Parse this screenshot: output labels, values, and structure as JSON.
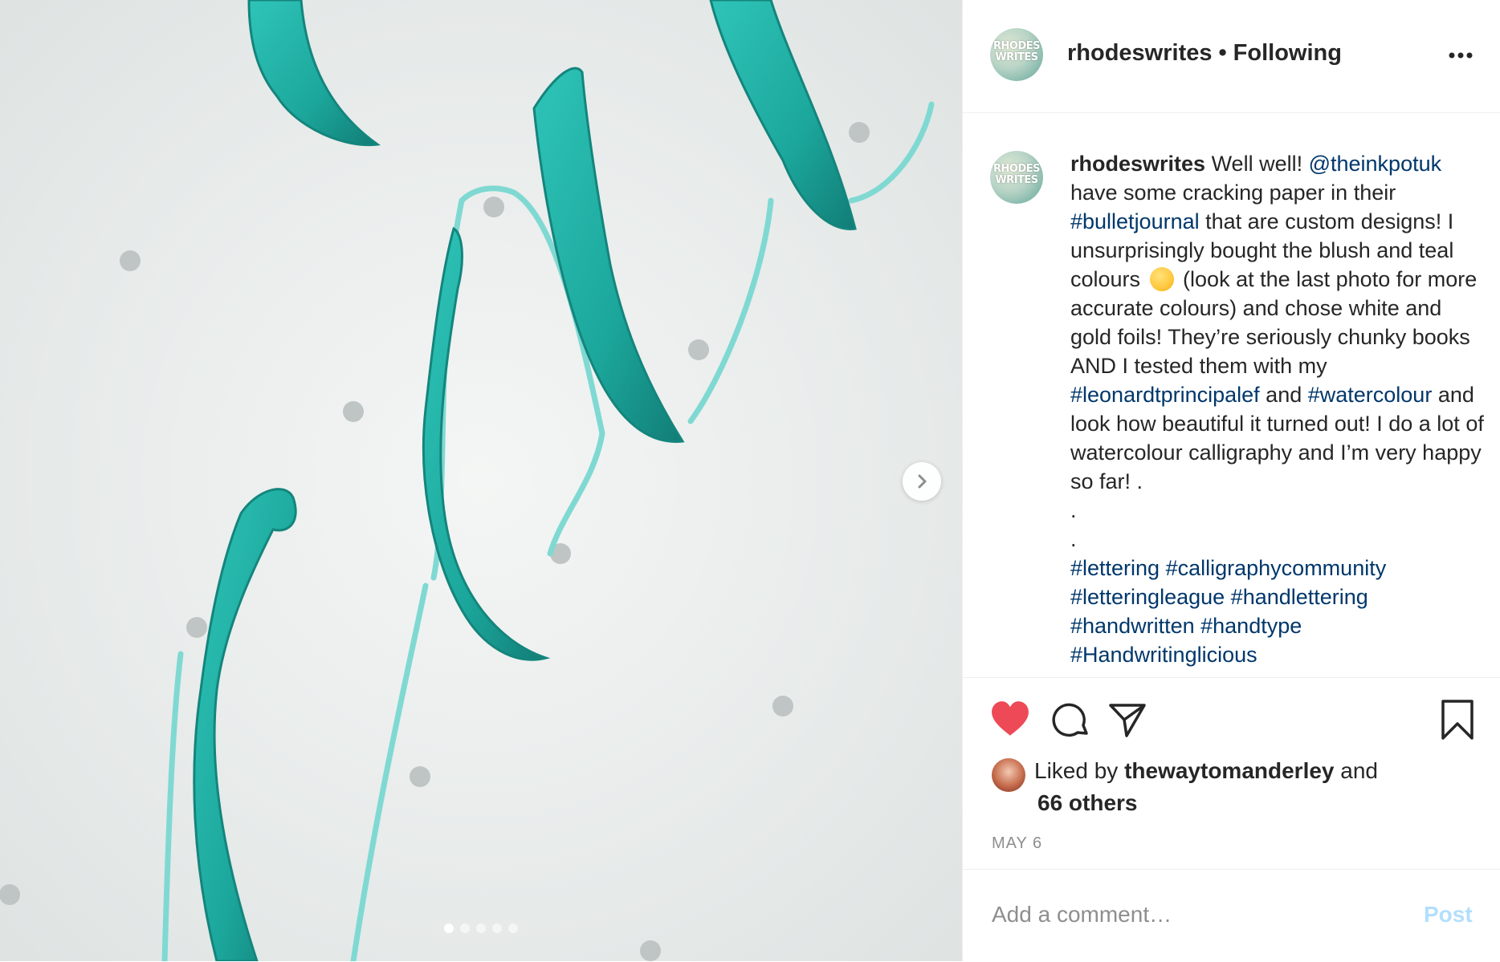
{
  "post": {
    "username": "rhodeswrites",
    "separator": "•",
    "follow_status": "Following",
    "avatar_text_line1": "RHODES",
    "avatar_text_line2": "WRITES"
  },
  "caption": {
    "username": "rhodeswrites",
    "t1": " Well well! ",
    "mention": "@theinkpotuk",
    "t2": " have some cracking paper in their ",
    "tag_bulletjournal": "#bulletjournal",
    "t3": " that are custom designs! I unsurprisingly bought the blush and teal colours ",
    "t4": " (look at the last photo for more accurate colours) and chose white and gold foils! They’re seriously chunky books AND I tested them with my ",
    "tag_leonardt": "#leonardtprincipalef",
    "t5": " and ",
    "tag_watercolour": "#watercolour",
    "t6": " and look how beautiful it turned out! I do a lot of watercolour calligraphy and I’m very happy so far! .",
    "dot1": ".",
    "dot2": ".",
    "tags": [
      "#lettering",
      "#calligraphycommunity",
      "#letteringleague",
      "#handlettering",
      "#handwritten",
      "#handtype",
      "#Handwritinglicious"
    ],
    "emoji_name": "upside-down-face-emoji"
  },
  "likes": {
    "prefix": "Liked by ",
    "user": "thewaytomanderley",
    "suffix": " and",
    "others": "66 others"
  },
  "date": "MAY 6",
  "comment": {
    "placeholder": "Add a comment…",
    "post_label": "Post"
  },
  "carousel": {
    "total_dots": 5,
    "active_index": 0
  },
  "colors": {
    "heart": "#ed4956",
    "link": "#00376b",
    "post_disabled": "#b2dffc",
    "muted": "#8e8e8e",
    "teal_ink": "#1fb3a8"
  },
  "icons": [
    "heart-icon",
    "comment-icon",
    "share-icon",
    "bookmark-icon",
    "more-icon",
    "chevron-right-icon"
  ]
}
